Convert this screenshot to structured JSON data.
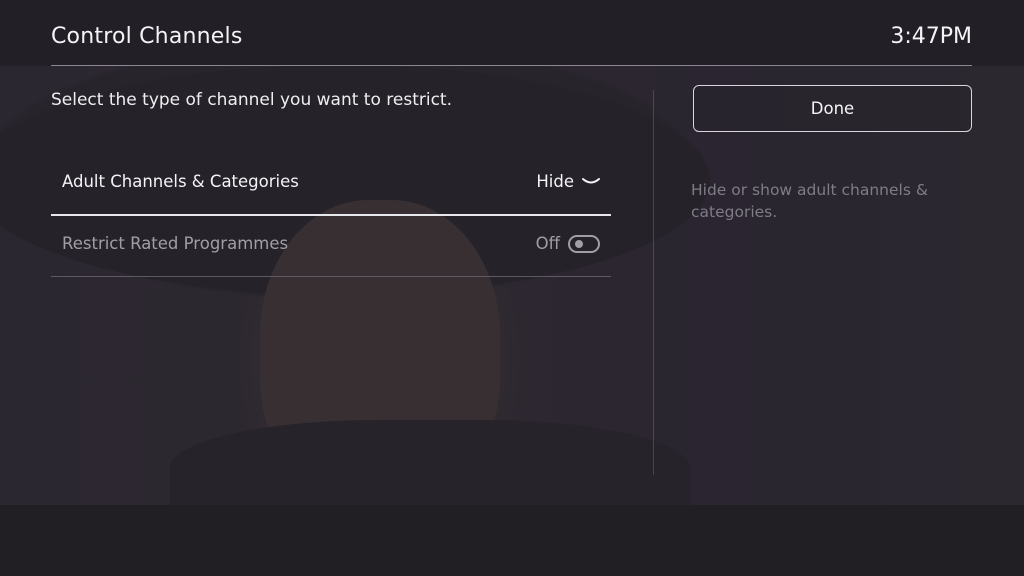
{
  "header": {
    "title": "Control Channels",
    "clock": "3:47PM"
  },
  "main": {
    "instruction": "Select the type of channel you want to restrict.",
    "rows": [
      {
        "label": "Adult Channels & Categories",
        "value": "Hide",
        "control": "dropdown",
        "icon": "chevron-down-icon",
        "focused": true
      },
      {
        "label": "Restrict Rated Programmes",
        "value": "Off",
        "control": "toggle",
        "icon": "toggle-off-icon",
        "focused": false
      }
    ]
  },
  "side": {
    "done_label": "Done",
    "help_text": "Hide or show adult channels & categories."
  },
  "colors": {
    "background": "#221f26",
    "text_primary": "#f4f4f6",
    "text_dim": "#a19ea6",
    "help_text": "#7f7c86",
    "divider": "#8a8790"
  }
}
